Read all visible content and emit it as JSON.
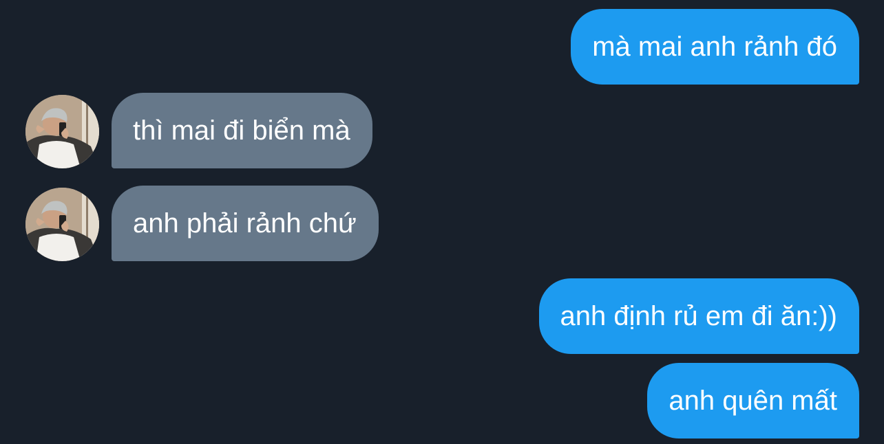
{
  "conversation": {
    "messages": [
      {
        "direction": "outgoing",
        "text": "mà mai anh rảnh đó"
      },
      {
        "direction": "incoming",
        "text": "thì mai đi biển mà"
      },
      {
        "direction": "incoming",
        "text": "anh phải rảnh chứ"
      },
      {
        "direction": "outgoing",
        "text": "anh định rủ em đi ăn:))"
      },
      {
        "direction": "outgoing",
        "text": "anh quên mất"
      }
    ]
  },
  "colors": {
    "background": "#18202b",
    "outgoing_bubble": "#1d9bf0",
    "incoming_bubble": "#66788a",
    "text": "#ffffff"
  },
  "icons": {
    "contact_avatar": "avatar-photo-icon"
  }
}
